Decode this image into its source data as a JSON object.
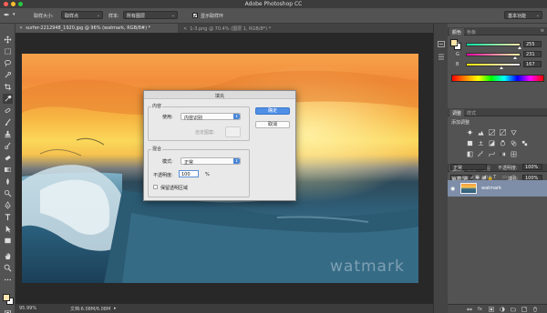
{
  "app": {
    "title": "Adobe Photoshop CC"
  },
  "options_bar": {
    "sample_size_label": "取样大小:",
    "sample_size_value": "取样点",
    "sample_label": "样本:",
    "sample_value": "所有图层",
    "show_ring_label": "显示取样环",
    "workspace": "基本功能"
  },
  "doc_tabs": [
    {
      "label": "surfer-2212948_1920.jpg @ 96% (watmark, RGB/8#) *"
    },
    {
      "label": "1-3.png @ 70.4% (图层 1, RGB/8*) *"
    }
  ],
  "status": {
    "zoom": "95.99%",
    "doc_info": "文档:6.08M/6.08M"
  },
  "canvas": {
    "watermark": "watmark"
  },
  "dialog": {
    "title": "填充",
    "contents_group": "内容",
    "use_label": "使用:",
    "use_value": "内容识别",
    "custom_pattern_label": "自定图案:",
    "blending_group": "混合",
    "mode_label": "模式:",
    "mode_value": "正常",
    "opacity_label": "不透明度:",
    "opacity_value": "100",
    "opacity_unit": "%",
    "preserve_label": "保留透明区域",
    "ok_label": "确定",
    "cancel_label": "取消"
  },
  "color_panel": {
    "tabs": [
      "颜色",
      "色板"
    ],
    "channels": [
      {
        "name": "R",
        "value": "255",
        "fraction": 1.0
      },
      {
        "name": "G",
        "value": "231",
        "fraction": 0.906
      },
      {
        "name": "B",
        "value": "167",
        "fraction": 0.655
      }
    ]
  },
  "adjustments_panel": {
    "tabs": [
      "调整",
      "样式"
    ],
    "add_label": "添加调整"
  },
  "layers_panel": {
    "tabs": [
      "图层",
      "通道",
      "路径"
    ],
    "kind_filter": "ρ 类型",
    "blend_mode": "正常",
    "opacity_label": "不透明度:",
    "opacity_value": "100%",
    "lock_label": "锁定:",
    "fill_label": "填充:",
    "fill_value": "100%",
    "layer_name": "watmark"
  },
  "colors": {
    "accent": "#4f8fe6",
    "panel": "#535353",
    "layer_selected": "#7e8ea8"
  }
}
